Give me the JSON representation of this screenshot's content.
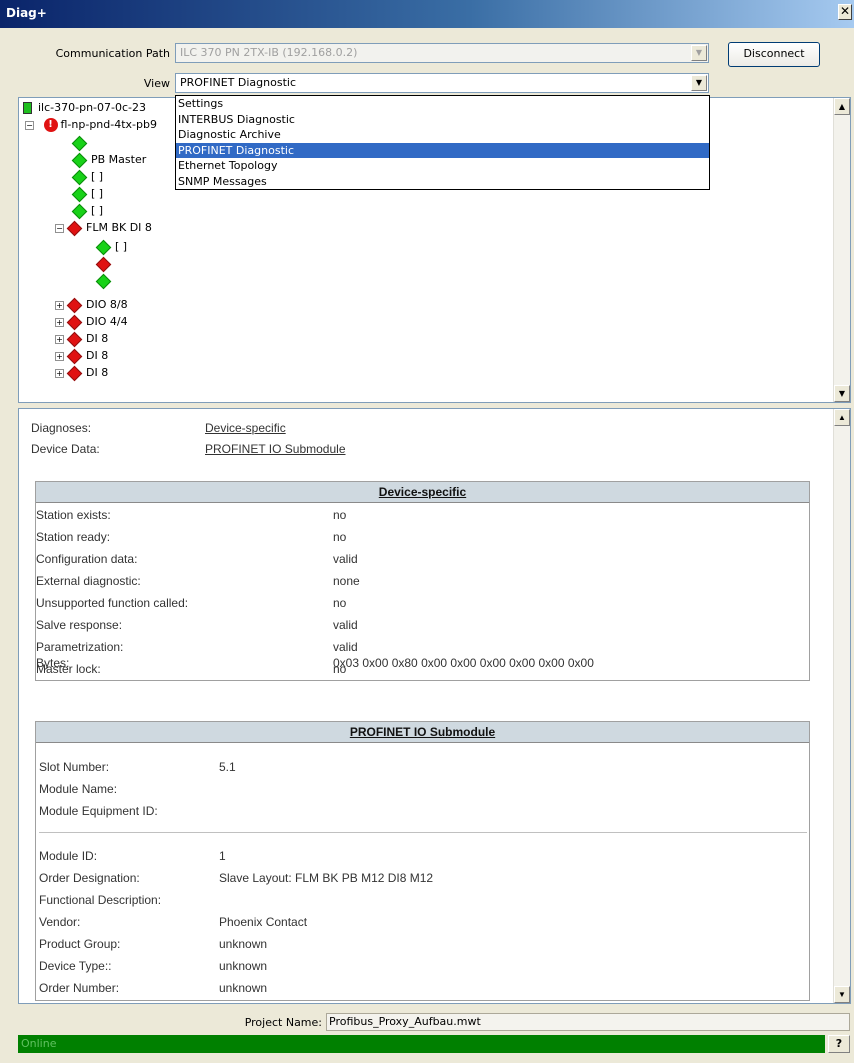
{
  "window": {
    "title": "Diag+",
    "close_glyph": "✕"
  },
  "toolbar": {
    "comm_path_label": "Communication Path",
    "comm_path_value": "ILC 370 PN 2TX-IB (192.168.0.2)",
    "view_label": "View",
    "view_value": "PROFINET Diagnostic",
    "disconnect_label": "Disconnect"
  },
  "view_options": [
    "Settings",
    "INTERBUS Diagnostic",
    "Diagnostic Archive",
    "PROFINET Diagnostic",
    "Ethernet Topology",
    "SNMP Messages"
  ],
  "tree": {
    "root": "ilc-370-pn-07-0c-23",
    "device": "fl-np-pnd-4tx-pb9",
    "nodes": [
      "PB Master",
      "[ ]",
      "[ ]",
      "[ ]",
      "FLM BK DI 8",
      "[ ]",
      "DIO 8/8",
      "DIO 4/4",
      "DI 8",
      "DI 8",
      "DI 8"
    ]
  },
  "details": {
    "diagnoses_label": "Diagnoses:",
    "diagnoses_link": "Device-specific",
    "device_data_label": "Device Data:",
    "device_data_link": "PROFINET IO Submodule",
    "device_specific": {
      "header": "Device-specific",
      "rows": [
        {
          "label": "Station exists:",
          "value": "no"
        },
        {
          "label": "Station ready:",
          "value": "no"
        },
        {
          "label": "Configuration data:",
          "value": "valid"
        },
        {
          "label": "External diagnostic:",
          "value": "none"
        },
        {
          "label": "Unsupported function called:",
          "value": "no"
        },
        {
          "label": "Salve response:",
          "value": "valid"
        },
        {
          "label": "Parametrization:",
          "value": "valid"
        },
        {
          "label": "Master lock:",
          "value": "no"
        },
        {
          "label": "Bytes:",
          "value": "0x03 0x00 0x80 0x00 0x00 0x00 0x00 0x00 0x00"
        }
      ]
    },
    "submodule": {
      "header": "PROFINET IO Submodule",
      "rows_top": [
        {
          "label": "Slot Number:",
          "value": "5.1"
        },
        {
          "label": "Module Name:",
          "value": ""
        },
        {
          "label": "Module Equipment ID:",
          "value": ""
        }
      ],
      "rows_bottom": [
        {
          "label": "Module ID:",
          "value": "1"
        },
        {
          "label": "Order Designation:",
          "value": "Slave Layout: FLM BK PB M12 DI8 M12"
        },
        {
          "label": "Functional Description:",
          "value": ""
        },
        {
          "label": "Vendor:",
          "value": "Phoenix Contact"
        },
        {
          "label": "Product Group:",
          "value": "unknown"
        },
        {
          "label": "Device Type::",
          "value": "unknown"
        },
        {
          "label": "Order Number:",
          "value": "unknown"
        }
      ]
    }
  },
  "footer": {
    "project_label": "Project Name:",
    "project_name": "Profibus_Proxy_Aufbau.mwt",
    "status": "Online",
    "help_label": "?"
  }
}
